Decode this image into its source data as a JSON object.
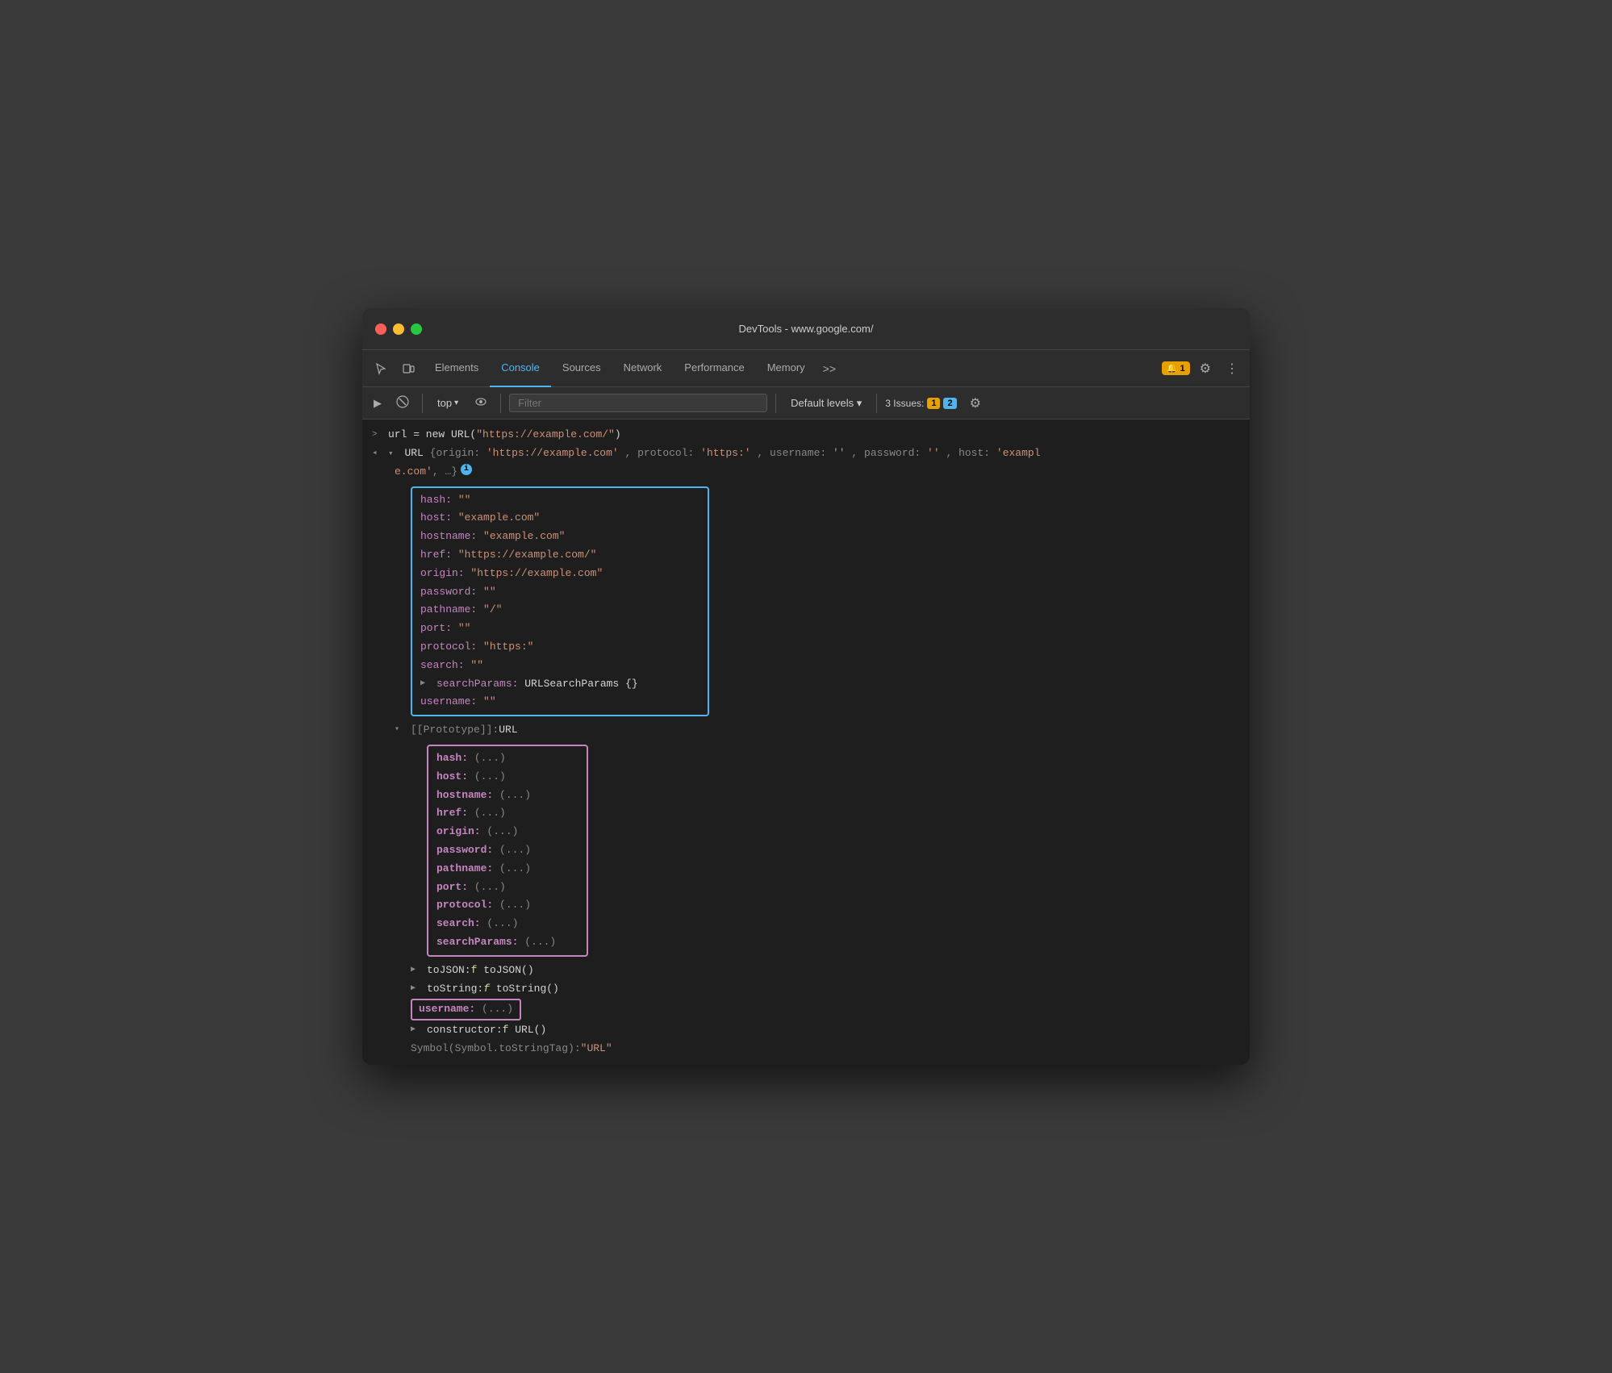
{
  "window": {
    "title": "DevTools - www.google.com/"
  },
  "tabs": {
    "items": [
      {
        "label": "Elements",
        "active": false
      },
      {
        "label": "Console",
        "active": true
      },
      {
        "label": "Sources",
        "active": false
      },
      {
        "label": "Network",
        "active": false
      },
      {
        "label": "Performance",
        "active": false
      },
      {
        "label": "Memory",
        "active": false
      }
    ],
    "more": ">>"
  },
  "console_toolbar": {
    "execute_icon": "▶",
    "clear_icon": "🚫",
    "top_label": "top",
    "eye_icon": "👁",
    "filter_placeholder": "Filter",
    "levels_label": "Default levels ▾",
    "issues_label": "3 Issues:",
    "warn_count": "1",
    "info_count": "2"
  },
  "console_content": {
    "line1": {
      "prefix": ">",
      "text": "url = new URL(\"https://example.com/\")"
    },
    "line2_prefix": "▾",
    "line2_url_label": "URL",
    "line2_obj": "{origin: 'https://example.com', protocol: 'https:', username: '', password: '', host: 'exampl",
    "line2_cont": "e.com', …}",
    "blue_box_items": [
      {
        "key": "hash:",
        "value": "\"\""
      },
      {
        "key": "host:",
        "value": "\"example.com\""
      },
      {
        "key": "hostname:",
        "value": "\"example.com\""
      },
      {
        "key": "href:",
        "value": "\"https://example.com/\""
      },
      {
        "key": "origin:",
        "value": "\"https://example.com\""
      },
      {
        "key": "password:",
        "value": "\"\""
      },
      {
        "key": "pathname:",
        "value": "\"/\""
      },
      {
        "key": "port:",
        "value": "\"\""
      },
      {
        "key": "protocol:",
        "value": "\"https:\""
      },
      {
        "key": "search:",
        "value": "\"\""
      }
    ],
    "searchParams_label": "searchParams:",
    "searchParams_value": "URLSearchParams {}",
    "username_label": "username:",
    "username_value": "\"\"",
    "prototype_label": "[[Prototype]]:",
    "prototype_value": "URL",
    "purple_box_items": [
      {
        "key": "hash:",
        "value": "(...)"
      },
      {
        "key": "host:",
        "value": "(...)"
      },
      {
        "key": "hostname:",
        "value": "(...)"
      },
      {
        "key": "href:",
        "value": "(...)"
      },
      {
        "key": "origin:",
        "value": "(...)"
      },
      {
        "key": "password:",
        "value": "(...)"
      },
      {
        "key": "pathname:",
        "value": "(...)"
      },
      {
        "key": "port:",
        "value": "(...)"
      },
      {
        "key": "protocol:",
        "value": "(...)"
      },
      {
        "key": "search:",
        "value": "(...)"
      },
      {
        "key": "searchParams:",
        "value": "(...)"
      }
    ],
    "toJSON_label": "▶",
    "toJSON_text": "toJSON: f toJSON()",
    "toString_label": "▶",
    "toString_text": "toString: f toString()",
    "username_proto_label": "username:",
    "username_proto_value": "(...)",
    "constructor_label": "▶",
    "constructor_text": "constructor: f URL()",
    "symbol_label": "Symbol(Symbol.toStringTag):",
    "symbol_value": "\"URL\""
  },
  "colors": {
    "accent_blue": "#4db6f0",
    "accent_purple": "#c586c0",
    "string_orange": "#ce9178",
    "key_blue": "#4db6f0",
    "comment_green": "#6a9955",
    "bg": "#1e1e1e",
    "toolbar_bg": "#2d2d2d"
  }
}
